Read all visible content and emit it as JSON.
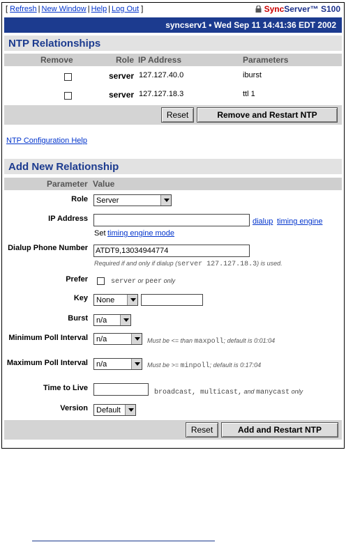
{
  "toolbar": {
    "links": [
      "Refresh",
      "New Window",
      "Help",
      "Log Out"
    ],
    "brand_sync": "Sync",
    "brand_server": "Server™",
    "brand_model": "S100"
  },
  "status": {
    "text": "syncserv1  •  Wed Sep 11 14:41:36 EDT 2002"
  },
  "ntp": {
    "title": "NTP Relationships",
    "headers": {
      "remove": "Remove",
      "role": "Role",
      "ip": "IP Address",
      "params": "Parameters"
    },
    "rows": [
      {
        "role": "server",
        "ip": "127.127.40.0",
        "params": "iburst"
      },
      {
        "role": "server",
        "ip": "127.127.18.3",
        "params": "ttl 1"
      }
    ],
    "reset_label": "Reset",
    "remove_restart_label": "Remove and Restart NTP"
  },
  "help_link": "NTP Configuration Help",
  "add": {
    "title": "Add New Relationship",
    "header_param": "Parameter",
    "header_value": "Value",
    "role_label": "Role",
    "role_value": "Server",
    "ip_label": "IP Address",
    "ip_value": "",
    "dialup_link": "dialup",
    "timing_engine_link": "timing engine",
    "set_text": "Set",
    "timing_engine_mode_link": "timing engine mode",
    "dialup_phone_label": "Dialup Phone Number",
    "dialup_phone_value": "ATDT9,13034944774",
    "dialup_note_a": "Required if and only if dialup (",
    "dialup_note_mono": "server 127.127.18.3",
    "dialup_note_b": ") is used.",
    "prefer_label": "Prefer",
    "prefer_note_mono_a": "server",
    "prefer_note_b": "or",
    "prefer_note_mono_c": "peer",
    "prefer_note_d": "only",
    "key_label": "Key",
    "key_value": "None",
    "key_text": "",
    "burst_label": "Burst",
    "burst_value": "n/a",
    "minpoll_label": "Minimum Poll Interval",
    "minpoll_value": "n/a",
    "minpoll_note_a": "Must be <= than",
    "minpoll_note_mono": "maxpoll",
    "minpoll_note_b": "; default is 0:01:04",
    "maxpoll_label": "Maximum Poll Interval",
    "maxpoll_value": "n/a",
    "maxpoll_note_a": "Must be >=",
    "maxpoll_note_mono": "minpoll",
    "maxpoll_note_b": "; default is 0:17:04",
    "ttl_label": "Time to Live",
    "ttl_value": "",
    "ttl_note_mono_a": "broadcast, multicast,",
    "ttl_note_and": "and",
    "ttl_note_mono_b": "manycast",
    "ttl_note_only": "only",
    "version_label": "Version",
    "version_value": "Default",
    "reset_label": "Reset",
    "add_restart_label": "Add and Restart NTP"
  }
}
